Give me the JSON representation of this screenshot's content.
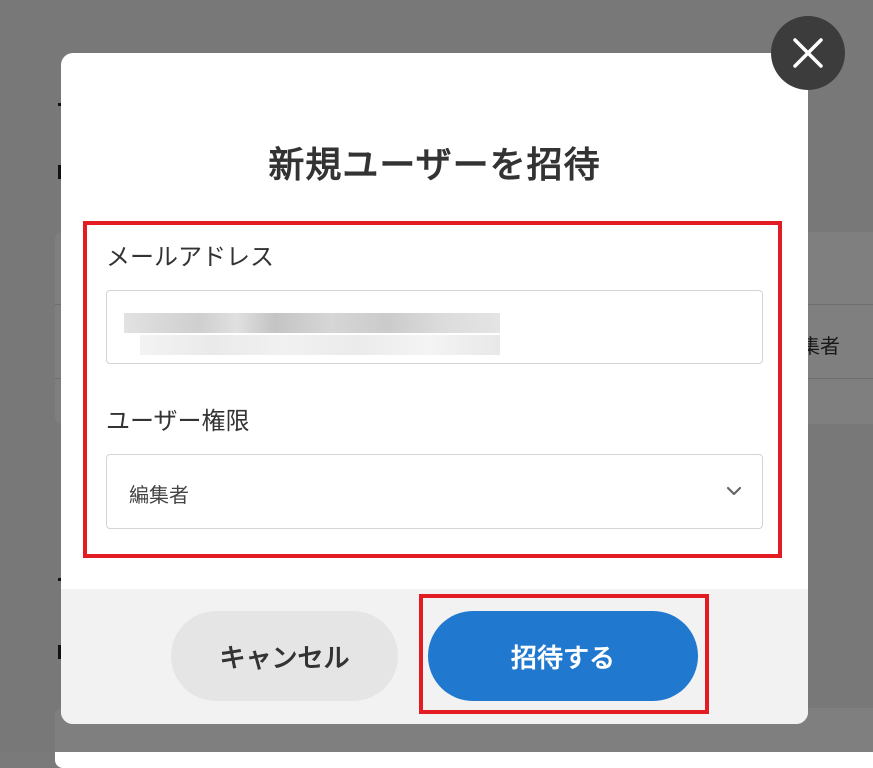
{
  "background": {
    "visible_role_text": "集者"
  },
  "modal": {
    "title": "新規ユーザーを招待",
    "email": {
      "label": "メールアドレス",
      "value": "",
      "placeholder": ""
    },
    "role": {
      "label": "ユーザー権限",
      "selected": "編集者"
    },
    "buttons": {
      "cancel": "キャンセル",
      "invite": "招待する"
    },
    "close_icon": "close-icon",
    "dropdown_icon": "chevron-down-icon"
  },
  "colors": {
    "primary": "#2178cf",
    "highlight": "#e31b23",
    "cancel_bg": "#e5e5e5",
    "close_bg": "#3c3c3c"
  }
}
